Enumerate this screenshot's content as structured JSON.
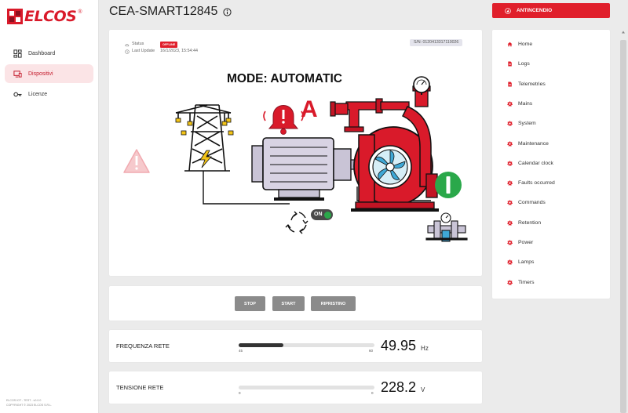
{
  "brand": {
    "logo_text": "ELCOS",
    "registered": "®"
  },
  "sidebar": {
    "items": [
      {
        "label": "Dashboard",
        "icon": "dashboard-icon"
      },
      {
        "label": "Dispositivi",
        "icon": "devices-icon"
      },
      {
        "label": "Licenze",
        "icon": "key-icon"
      }
    ],
    "active_index": 1,
    "footer_line1": "ELCOS IOT - TEST - v0.0.0",
    "footer_line2": "COPYRIGHT © 2023 ELCOS S.R.L."
  },
  "header": {
    "title": "CEA-SMART12845",
    "info_icon": "info-icon",
    "fire_button": "ANTINCENDIO",
    "fire_icon": "flame-icon"
  },
  "device": {
    "status_label": "Status",
    "status_value": "OFFLINE",
    "last_update_label": "Last Update",
    "last_update_value": "16/1/2023, 15:54:44",
    "serial": "S/N: 0120413317110026",
    "mode": "MODE: AUTOMATIC",
    "mode_letter": "A",
    "switch_label": "ON"
  },
  "controls": {
    "stop": "STOP",
    "start": "START",
    "reset": "RIPRISTINO"
  },
  "measurements": [
    {
      "label": "FREQUENZA RETE",
      "min": "45",
      "max": "60",
      "value": "49.95",
      "unit": "Hz",
      "fraction": 0.33
    },
    {
      "label": "TENSIONE RETE",
      "min": "0",
      "max": "0",
      "value": "228.2",
      "unit": "V",
      "fraction": 0
    }
  ],
  "menu": [
    {
      "label": "Home",
      "icon": "home-icon"
    },
    {
      "label": "Logs",
      "icon": "document-icon"
    },
    {
      "label": "Telemetries",
      "icon": "document-icon"
    },
    {
      "label": "Mains",
      "icon": "gear-icon"
    },
    {
      "label": "System",
      "icon": "gear-icon"
    },
    {
      "label": "Maintenance",
      "icon": "gear-icon"
    },
    {
      "label": "Calendar clock",
      "icon": "gear-icon"
    },
    {
      "label": "Faults occurred",
      "icon": "gear-icon"
    },
    {
      "label": "Commands",
      "icon": "gear-icon"
    },
    {
      "label": "Retention",
      "icon": "gear-icon"
    },
    {
      "label": "Power",
      "icon": "gear-icon"
    },
    {
      "label": "Lamps",
      "icon": "gear-icon"
    },
    {
      "label": "Timers",
      "icon": "gear-icon"
    }
  ],
  "colors": {
    "accent": "#e01f2b",
    "active_bg": "#fbe4e6",
    "pump": "#d91a2a",
    "ok_green": "#2aa84a"
  }
}
